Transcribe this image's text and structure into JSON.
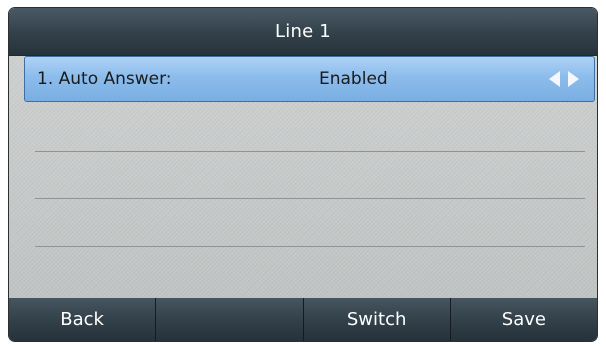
{
  "header": {
    "title": "Line 1"
  },
  "setting": {
    "label": "1. Auto Answer:",
    "value": "Enabled",
    "left_arrow_icon": "triangle-left-icon",
    "right_arrow_icon": "triangle-right-icon"
  },
  "softkeys": [
    {
      "label": "Back"
    },
    {
      "label": ""
    },
    {
      "label": "Switch"
    },
    {
      "label": "Save"
    }
  ],
  "colors": {
    "title_bar": "#34424c",
    "selected_row": "#8cbcec",
    "background": "#c8caca",
    "softkey": "#33414a"
  }
}
